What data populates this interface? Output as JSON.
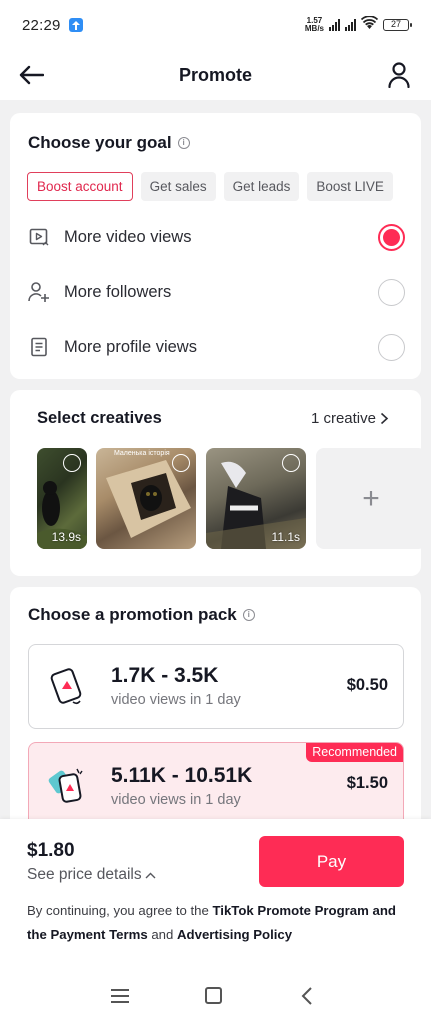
{
  "status_bar": {
    "time": "22:29",
    "net_speed_value": "1.57",
    "net_speed_unit": "MB/s",
    "battery": "27"
  },
  "header": {
    "title": "Promote"
  },
  "goal": {
    "title": "Choose your goal",
    "tabs": [
      {
        "label": "Boost account",
        "active": true
      },
      {
        "label": "Get sales",
        "active": false
      },
      {
        "label": "Get leads",
        "active": false
      },
      {
        "label": "Boost LIVE",
        "active": false
      }
    ],
    "options": [
      {
        "label": "More video views",
        "selected": true,
        "icon": "video-play-icon"
      },
      {
        "label": "More followers",
        "selected": false,
        "icon": "add-user-icon"
      },
      {
        "label": "More profile views",
        "selected": false,
        "icon": "profile-page-icon"
      }
    ]
  },
  "creatives": {
    "title": "Select creatives",
    "count_label": "1 creative",
    "items": [
      {
        "duration": "13.9s",
        "caption": ""
      },
      {
        "duration": "",
        "caption": "Маленька історія"
      },
      {
        "duration": "11.1s",
        "caption": ""
      }
    ],
    "add_label": "+"
  },
  "pack": {
    "title": "Choose a promotion pack",
    "items": [
      {
        "views": "1.7K - 3.5K",
        "sub": "video views in 1 day",
        "price": "$0.50",
        "recommended": false
      },
      {
        "views": "5.11K - 10.51K",
        "sub": "video views in 1 day",
        "price": "$1.50",
        "recommended": true,
        "badge": "Recommended"
      }
    ]
  },
  "checkout": {
    "total": "$1.80",
    "details_label": "See price details",
    "pay_label": "Pay",
    "terms_prefix": "By continuing, you agree to the ",
    "terms_link1": "TikTok Promote Program and the Payment Terms",
    "terms_and": " and ",
    "terms_link2": "Advertising Policy"
  },
  "colors": {
    "accent": "#fe2c55",
    "recommended_bg": "#fdebee",
    "page_bg": "#f1f1f2"
  }
}
